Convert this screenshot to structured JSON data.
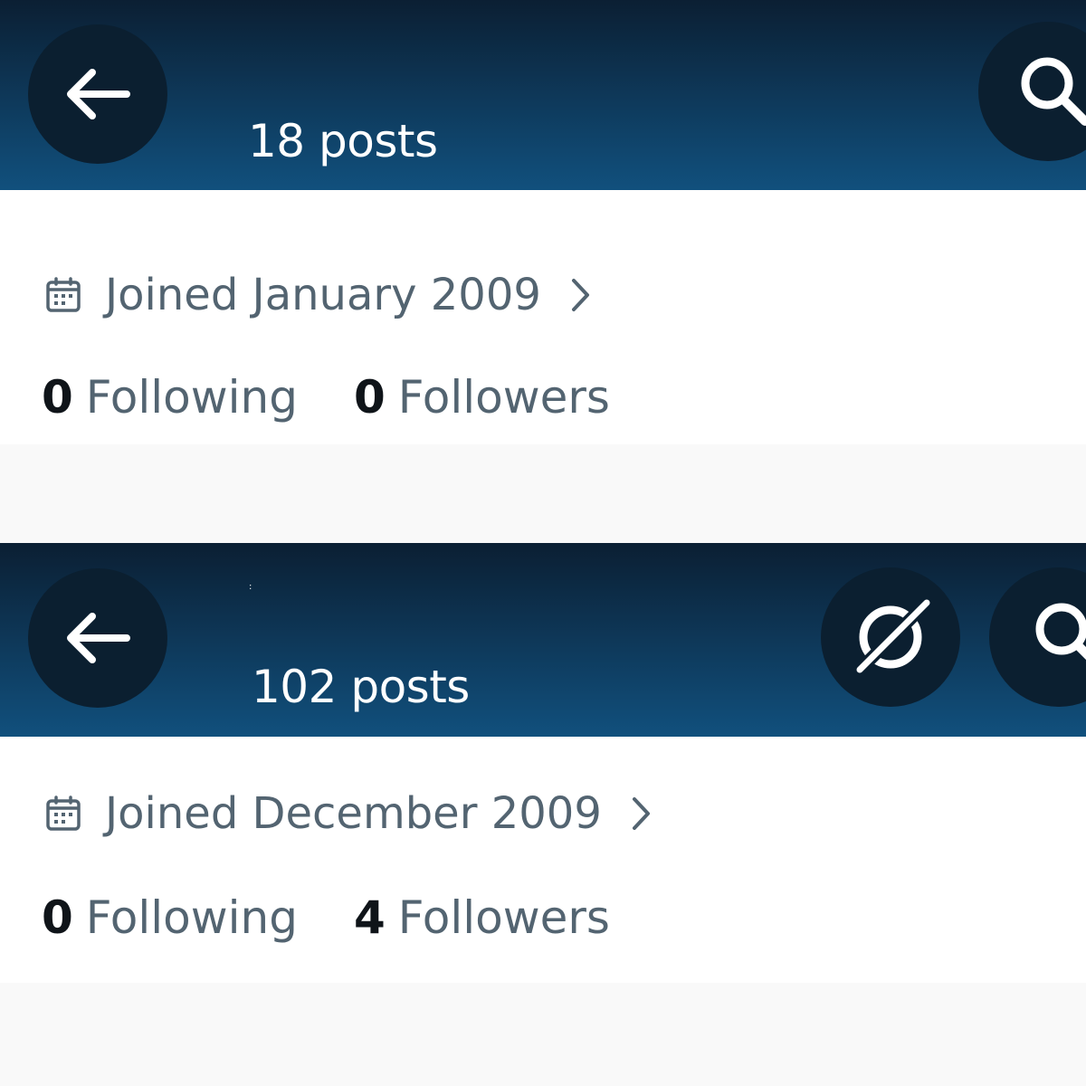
{
  "profiles": [
    {
      "header": {
        "posts_count": "18 posts",
        "back_icon": "arrow-left-icon",
        "search_icon": "search-icon"
      },
      "joined": {
        "icon": "calendar-icon",
        "text": "Joined January 2009",
        "chevron_icon": "chevron-right-icon"
      },
      "stats": {
        "following_count": "0",
        "following_label": "Following",
        "followers_count": "0",
        "followers_label": "Followers"
      }
    },
    {
      "header": {
        "posts_count": "102 posts",
        "tiny_mark": ":",
        "back_icon": "arrow-left-icon",
        "grok_icon": "grok-icon",
        "search_icon": "search-icon"
      },
      "joined": {
        "icon": "calendar-icon",
        "text": "Joined December 2009",
        "chevron_icon": "chevron-right-icon"
      },
      "stats": {
        "following_count": "0",
        "following_label": "Following",
        "followers_count": "4",
        "followers_label": "Followers"
      }
    }
  ],
  "colors": {
    "header_top": "#0b1f33",
    "header_bottom": "#11507d",
    "button_bg": "#0b1f30",
    "secondary_text": "#536471",
    "primary_text": "#0f1419",
    "page_bg": "#f9f9f9"
  }
}
